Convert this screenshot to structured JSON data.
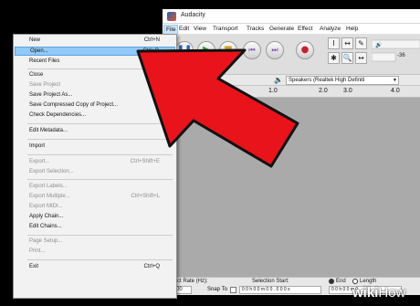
{
  "window": {
    "title": "Audacity"
  },
  "menubar": [
    "File",
    "Edit",
    "View",
    "Transport",
    "Tracks",
    "Generate",
    "Effect",
    "Analyze",
    "Help"
  ],
  "file_menu": {
    "items": [
      {
        "label": "New",
        "shortcut": "Ctrl+N",
        "enabled": true
      },
      {
        "label": "Open...",
        "shortcut": "Ctrl+O",
        "enabled": true,
        "highlighted": true
      },
      {
        "label": "Recent Files",
        "shortcut": "",
        "enabled": true
      },
      {
        "label": "Close",
        "shortcut": "Ct",
        "enabled": true
      },
      {
        "label": "Save Project",
        "shortcut": "",
        "enabled": false
      },
      {
        "label": "Save Project As...",
        "shortcut": "",
        "enabled": true
      },
      {
        "label": "Save Compressed Copy of Project...",
        "shortcut": "",
        "enabled": true
      },
      {
        "label": "Check Dependencies...",
        "shortcut": "",
        "enabled": true
      },
      {
        "label": "Edit Metadata...",
        "shortcut": "",
        "enabled": true
      },
      {
        "label": "Import",
        "shortcut": "",
        "enabled": true,
        "submenu": true
      },
      {
        "label": "Export...",
        "shortcut": "Ctrl+Shift+E",
        "enabled": false
      },
      {
        "label": "Export Selection...",
        "shortcut": "",
        "enabled": false
      },
      {
        "label": "Export Labels...",
        "shortcut": "",
        "enabled": false
      },
      {
        "label": "Export Multiple...",
        "shortcut": "Ctrl+Shift+L",
        "enabled": false
      },
      {
        "label": "Export MIDI...",
        "shortcut": "",
        "enabled": false
      },
      {
        "label": "Apply Chain...",
        "shortcut": "",
        "enabled": true
      },
      {
        "label": "Edit Chains...",
        "shortcut": "",
        "enabled": true
      },
      {
        "label": "Page Setup...",
        "shortcut": "",
        "enabled": false
      },
      {
        "label": "Print...",
        "shortcut": "",
        "enabled": false
      },
      {
        "label": "Exit",
        "shortcut": "Ctrl+Q",
        "enabled": true
      }
    ]
  },
  "toolbar": {
    "tools": [
      "I",
      "↔",
      "✎",
      "✱",
      "🔍",
      "↔"
    ],
    "meter_label": "-36"
  },
  "device": {
    "output": "Speakers (Realtek High Definiti"
  },
  "ruler": [
    "1.0",
    "2.0",
    "3.0",
    "4.0"
  ],
  "selection": {
    "rate_label": "Project Rate (Hz):",
    "rate_value": "44100",
    "snap_label": "Snap To",
    "start_label": "Selection Start:",
    "start_value": "0 0 h 0 0 m 0 0 . 0 0 0 s",
    "end_label": "End",
    "length_label": "Length",
    "end_value": "0 0 h 0 0 m 0"
  },
  "watermark": {
    "wiki": "wiki",
    "how": "How"
  },
  "colors": {
    "arrow": "#e8131b",
    "highlight": "#91c9f7",
    "tracks_bg": "#aaaaaa"
  }
}
